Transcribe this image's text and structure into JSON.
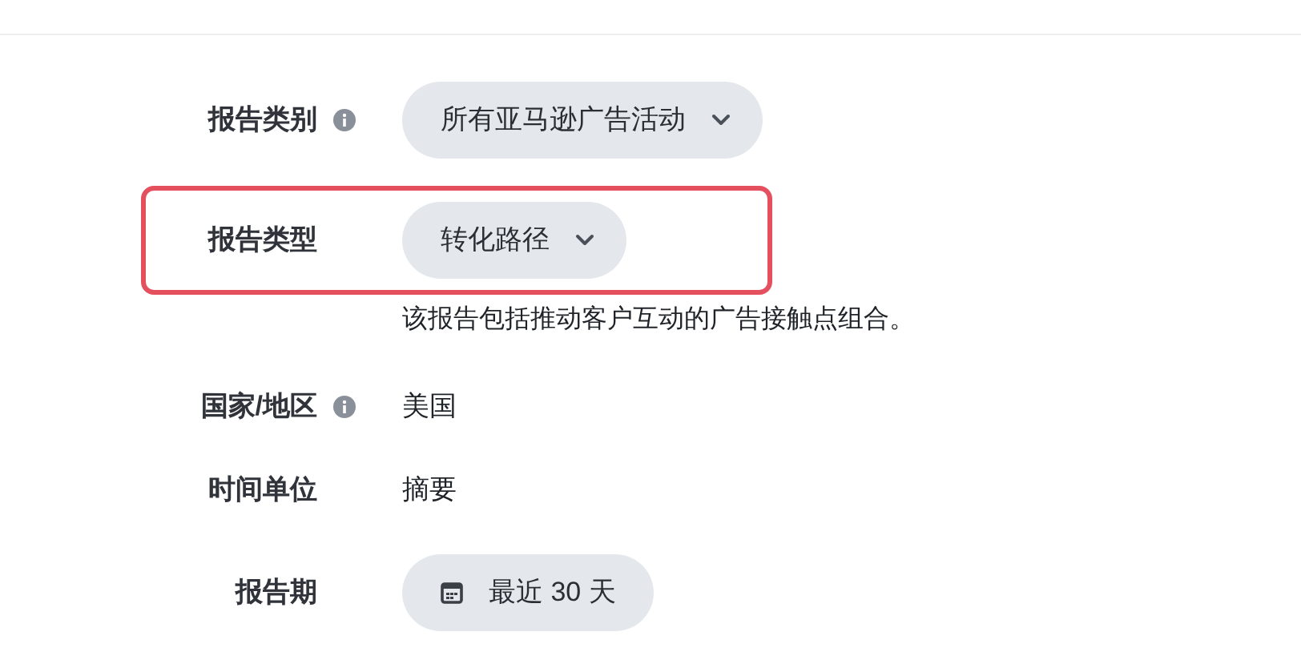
{
  "fields": [
    {
      "label": "报告类别",
      "info": true,
      "kind": "dropdown",
      "value": "所有亚马逊广告活动"
    },
    {
      "label": "报告类型",
      "kind": "dropdown",
      "value": "转化路径",
      "highlighted": true,
      "description": "该报告包括推动客户互动的广告接触点组合。"
    },
    {
      "label": "国家/地区",
      "info": true,
      "kind": "text",
      "value": "美国"
    },
    {
      "label": "时间单位",
      "kind": "text",
      "value": "摘要"
    },
    {
      "label": "报告期",
      "kind": "date",
      "value": "最近 30 天"
    }
  ]
}
